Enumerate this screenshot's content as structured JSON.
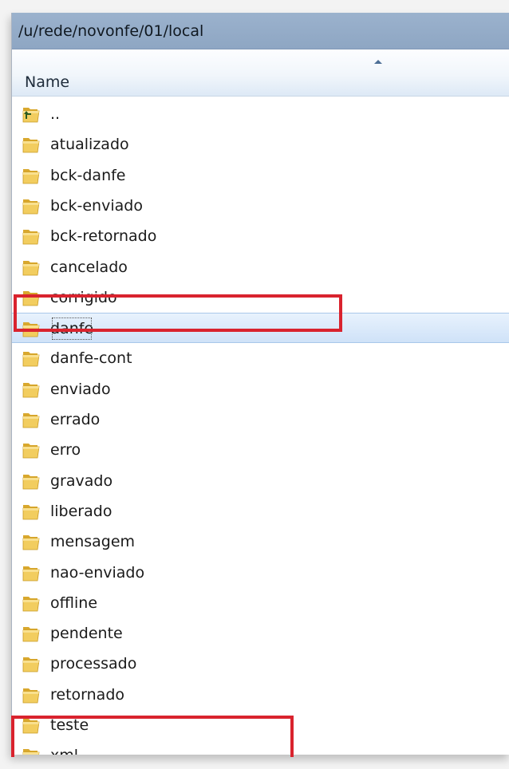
{
  "path": "/u/rede/novonfe/01/local",
  "column_header": {
    "name_label": "Name",
    "sort_icon": "sort-ascending-icon"
  },
  "items": [
    {
      "label": "..",
      "icon": "parent-folder-icon",
      "selected": false
    },
    {
      "label": "atualizado",
      "icon": "folder-icon",
      "selected": false
    },
    {
      "label": "bck-danfe",
      "icon": "folder-icon",
      "selected": false
    },
    {
      "label": "bck-enviado",
      "icon": "folder-icon",
      "selected": false
    },
    {
      "label": "bck-retornado",
      "icon": "folder-icon",
      "selected": false
    },
    {
      "label": "cancelado",
      "icon": "folder-icon",
      "selected": false
    },
    {
      "label": "corrigido",
      "icon": "folder-icon",
      "selected": false
    },
    {
      "label": "danfe",
      "icon": "folder-icon",
      "selected": true
    },
    {
      "label": "danfe-cont",
      "icon": "folder-icon",
      "selected": false
    },
    {
      "label": "enviado",
      "icon": "folder-icon",
      "selected": false
    },
    {
      "label": "errado",
      "icon": "folder-icon",
      "selected": false
    },
    {
      "label": "erro",
      "icon": "folder-icon",
      "selected": false
    },
    {
      "label": "gravado",
      "icon": "folder-icon",
      "selected": false
    },
    {
      "label": "liberado",
      "icon": "folder-icon",
      "selected": false
    },
    {
      "label": "mensagem",
      "icon": "folder-icon",
      "selected": false
    },
    {
      "label": "nao-enviado",
      "icon": "folder-icon",
      "selected": false
    },
    {
      "label": "offline",
      "icon": "folder-icon",
      "selected": false
    },
    {
      "label": "pendente",
      "icon": "folder-icon",
      "selected": false
    },
    {
      "label": "processado",
      "icon": "folder-icon",
      "selected": false
    },
    {
      "label": "retornado",
      "icon": "folder-icon",
      "selected": false
    },
    {
      "label": "teste",
      "icon": "folder-icon",
      "selected": false
    },
    {
      "label": "xml",
      "icon": "folder-icon",
      "selected": false
    }
  ],
  "highlight_color": "#d9232e",
  "highlighted_items": [
    "danfe",
    "xml"
  ]
}
